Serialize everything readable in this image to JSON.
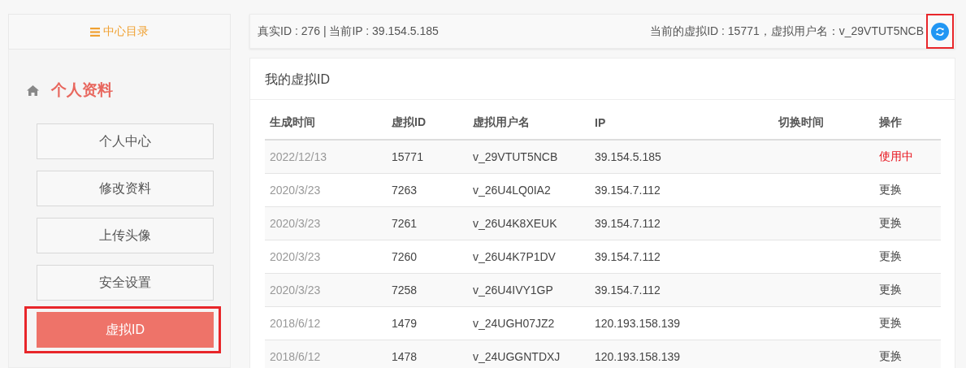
{
  "sidebar": {
    "header": "中心目录",
    "section_title": "个人资料",
    "items": [
      {
        "label": "个人中心",
        "selected": false,
        "highlighted": false
      },
      {
        "label": "修改资料",
        "selected": false,
        "highlighted": false
      },
      {
        "label": "上传头像",
        "selected": false,
        "highlighted": false
      },
      {
        "label": "安全设置",
        "selected": false,
        "highlighted": false
      },
      {
        "label": "虚拟ID",
        "selected": true,
        "highlighted": true
      }
    ]
  },
  "info_bar": {
    "left": "真实ID : 276 | 当前IP : 39.154.5.185",
    "right": "当前的虚拟ID : 15771，虚拟用户名：v_29VTUT5NCB",
    "refresh_highlighted": true
  },
  "card": {
    "title": "我的虚拟ID",
    "table": {
      "columns": [
        "生成时间",
        "虚拟ID",
        "虚拟用户名",
        "IP",
        "切换时间",
        "操作"
      ],
      "rows": [
        {
          "cells": [
            "2022/12/13",
            "15771",
            "v_29VTUT5NCB",
            "39.154.5.185",
            ""
          ],
          "action": {
            "kind": "status",
            "label": "使用中"
          }
        },
        {
          "cells": [
            "2020/3/23",
            "7263",
            "v_26U4LQ0IA2",
            "39.154.7.112",
            ""
          ],
          "action": {
            "kind": "link",
            "label": "更换"
          }
        },
        {
          "cells": [
            "2020/3/23",
            "7261",
            "v_26U4K8XEUK",
            "39.154.7.112",
            ""
          ],
          "action": {
            "kind": "link",
            "label": "更换"
          }
        },
        {
          "cells": [
            "2020/3/23",
            "7260",
            "v_26U4K7P1DV",
            "39.154.7.112",
            ""
          ],
          "action": {
            "kind": "link",
            "label": "更换"
          }
        },
        {
          "cells": [
            "2020/3/23",
            "7258",
            "v_26U4IVY1GP",
            "39.154.7.112",
            ""
          ],
          "action": {
            "kind": "link",
            "label": "更换"
          }
        },
        {
          "cells": [
            "2018/6/12",
            "1479",
            "v_24UGH07JZ2",
            "120.193.158.139",
            ""
          ],
          "action": {
            "kind": "link",
            "label": "更换"
          }
        },
        {
          "cells": [
            "2018/6/12",
            "1478",
            "v_24UGGNTDXJ",
            "120.193.158.139",
            ""
          ],
          "action": {
            "kind": "link",
            "label": "更换"
          }
        }
      ]
    }
  }
}
